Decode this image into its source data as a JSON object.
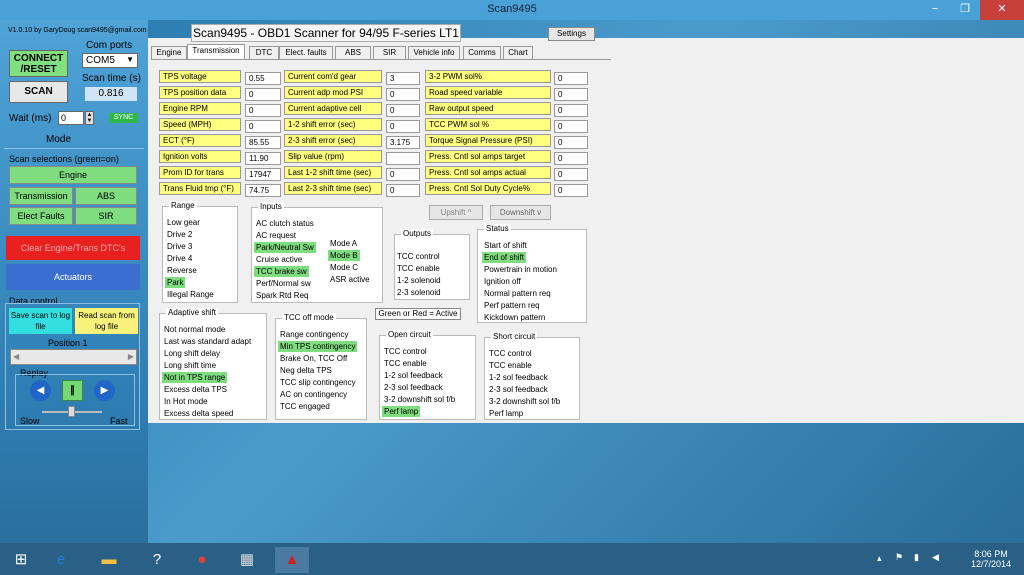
{
  "window": {
    "title": "Scan9495",
    "minimize": "−",
    "maximize": "❐",
    "close": "✕"
  },
  "left": {
    "version": "V1.0.10  by GaryDoug  scan9495@gmail.com",
    "connect": "CONNECT /RESET",
    "comports_label": "Com ports",
    "com_value": "COM5",
    "scantime_label": "Scan time (s)",
    "scantime_value": "0.816",
    "scan": "SCAN",
    "wait_label": "Wait (ms)",
    "wait_value": "0",
    "sync": "SYNC",
    "mode": "Mode",
    "scansel_label": "Scan selections (green=on)",
    "engine": "Engine",
    "transmission": "Transmission",
    "abs": "ABS",
    "elect_faults": "Elect Faults",
    "sir": "SIR",
    "clear": "Clear Engine/Trans DTC's",
    "actuators": "Actuators",
    "datacontrol": "Data control",
    "save": "Save scan to log file",
    "read": "Read scan from log file",
    "position_label": "Position",
    "position_value": "1",
    "replay": "Replay",
    "slow": "Slow",
    "fast": "Fast"
  },
  "header": {
    "title": "Scan9495 - OBD1 Scanner for 94/95 F-series LT1",
    "settings": "Settings"
  },
  "tabs": [
    "Engine",
    "Transmission",
    "DTC",
    "Elect. faults",
    "ABS",
    "SIR",
    "Vehicle info",
    "Comms",
    "Chart"
  ],
  "params": {
    "col1": [
      [
        "TPS voltage",
        "0.55"
      ],
      [
        "TPS position data",
        "0"
      ],
      [
        "Engine RPM",
        "0"
      ],
      [
        "Speed (MPH)",
        "0"
      ],
      [
        "ECT (°F)",
        "85.55"
      ],
      [
        "Ignition volts",
        "11.90"
      ],
      [
        "Prom ID for trans",
        "17947"
      ],
      [
        "Trans Fluid tmp (°F)",
        "74.75"
      ]
    ],
    "col2": [
      [
        "Current com'd gear",
        "3"
      ],
      [
        "Current adp mod PSI",
        "0"
      ],
      [
        "Current adaptive cell",
        "0"
      ],
      [
        "1-2 shift error (sec)",
        "0"
      ],
      [
        "2-3 shift error (sec)",
        "3.175"
      ],
      [
        "Slip value (rpm)",
        ""
      ],
      [
        "Last 1-2 shift time (sec)",
        "0"
      ],
      [
        "Last 2-3 shift time (sec)",
        "0"
      ]
    ],
    "col3": [
      [
        "3-2 PWM sol%",
        "0"
      ],
      [
        "Road speed variable",
        "0"
      ],
      [
        "Raw output speed",
        "0"
      ],
      [
        "TCC PWM sol %",
        "0"
      ],
      [
        "Torque Signal Pressure (PSI)",
        "0"
      ],
      [
        "Press. Cntl sol amps target",
        "0"
      ],
      [
        "Press. Cntl sol amps actual",
        "0"
      ],
      [
        "Press. Cntl Sol Duty Cycle%",
        "0"
      ]
    ]
  },
  "range": {
    "title": "Range",
    "items": [
      "Low gear",
      "Drive 2",
      "Drive 3",
      "Drive 4",
      "Reverse",
      "Park",
      "Illegal Range"
    ]
  },
  "inputs": {
    "title": "Inputs",
    "items": [
      "AC clutch status",
      "AC request",
      "Park/Neutral Sw",
      "Cruise active",
      "TCC brake sw",
      "Perf/Normal sw",
      "Spark Rtd Req"
    ],
    "items2": [
      "Mode A",
      "Mode B",
      "Mode C",
      "ASR active"
    ]
  },
  "upshift": "Upshift ^",
  "downshift": "Downshift v",
  "outputs": {
    "title": "Outputs",
    "items": [
      "TCC control",
      "TCC enable",
      "1-2 solenoid",
      "2-3 solenoid"
    ]
  },
  "status": {
    "title": "Status",
    "items": [
      "Start of shift",
      "End of shift",
      "Powertrain in motion",
      "Ignition off",
      "Normal pattern req",
      "Perf pattern req",
      "Kickdown pattern"
    ]
  },
  "legend": "Green or Red = Active",
  "adaptive": {
    "title": "Adaptive shift",
    "items": [
      "Not normal mode",
      "Last was standard adapt",
      "Long shift delay",
      "Long shift time",
      "Not in TPS range",
      "Excess delta TPS",
      "In Hot mode",
      "Excess delta speed"
    ]
  },
  "tccoff": {
    "title": "TCC off mode",
    "items": [
      "Range contingency",
      "Min TPS contingency",
      "Brake On, TCC Off",
      "Neg delta TPS",
      "TCC slip contingency",
      "AC on contingency",
      "TCC engaged"
    ]
  },
  "open": {
    "title": "Open circuit",
    "items": [
      "TCC control",
      "TCC enable",
      "1-2 sol feedback",
      "2-3 sol feedback",
      "3-2 downshift sol f/b",
      "Perf lamp"
    ]
  },
  "short": {
    "title": "Short circuit",
    "items": [
      "TCC control",
      "TCC enable",
      "1-2 sol feedback",
      "2-3 sol feedback",
      "3-2 downshift sol f/b",
      "Perf lamp"
    ]
  },
  "taskbar": {
    "time": "8:06 PM",
    "date": "12/7/2014"
  }
}
